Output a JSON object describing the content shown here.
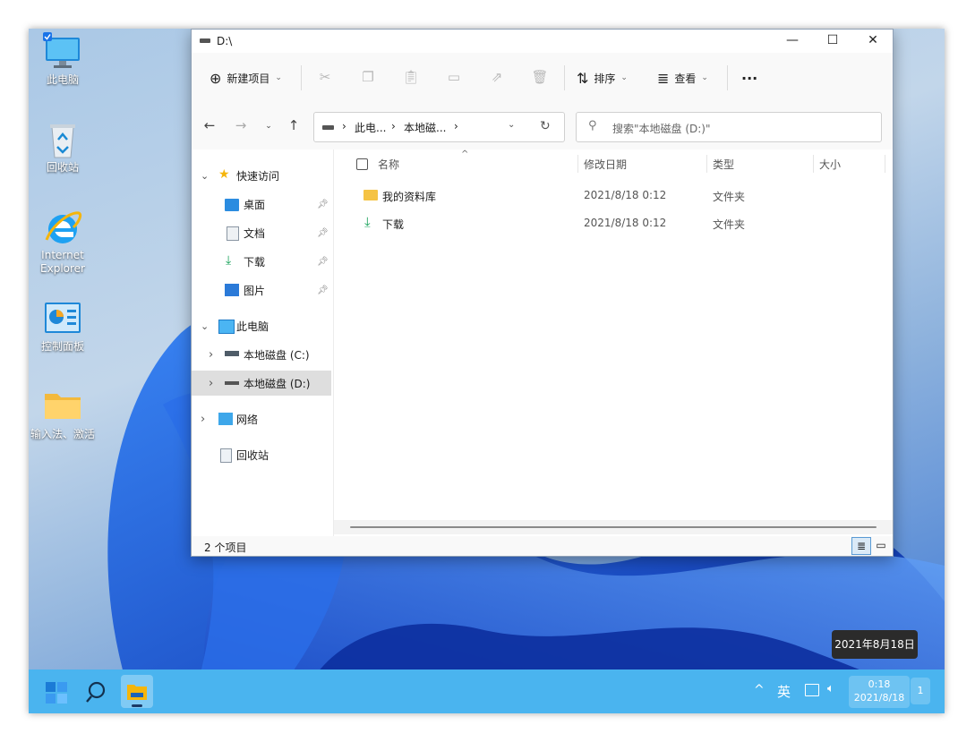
{
  "desktop": {
    "icons": [
      {
        "label": "此电脑"
      },
      {
        "label": "回收站"
      },
      {
        "label": "Internet Explorer"
      },
      {
        "label": "控制面板"
      },
      {
        "label": "输入法、激活"
      }
    ]
  },
  "window": {
    "title": "D:\\",
    "minimize": "—",
    "maximize": "☐",
    "close": "✕"
  },
  "toolbar": {
    "new_item": "新建项目",
    "sort": "排序",
    "view": "查看",
    "more": "···"
  },
  "nav": {
    "breadcrumb": [
      "此电...",
      "本地磁...",
      ""
    ],
    "search_placeholder": "搜索\"本地磁盘 (D:)\""
  },
  "sidebar": {
    "quick_access": "快速访问",
    "items": [
      {
        "label": "桌面"
      },
      {
        "label": "文档"
      },
      {
        "label": "下载"
      },
      {
        "label": "图片"
      }
    ],
    "this_pc": "此电脑",
    "drives": [
      {
        "label": "本地磁盘 (C:)"
      },
      {
        "label": "本地磁盘 (D:)"
      }
    ],
    "network": "网络",
    "recycle": "回收站"
  },
  "columns": {
    "name": "名称",
    "modified": "修改日期",
    "type": "类型",
    "size": "大小"
  },
  "files": [
    {
      "name": "我的资料库",
      "modified": "2021/8/18 0:12",
      "type": "文件夹"
    },
    {
      "name": "下载",
      "modified": "2021/8/18 0:12",
      "type": "文件夹"
    }
  ],
  "status": {
    "count": "2 个项目"
  },
  "tooltip": "2021年8月18日",
  "taskbar": {
    "ime": "英",
    "time": "0:18",
    "date": "2021/8/18",
    "badge": "1",
    "color": "#4ab4ef"
  }
}
